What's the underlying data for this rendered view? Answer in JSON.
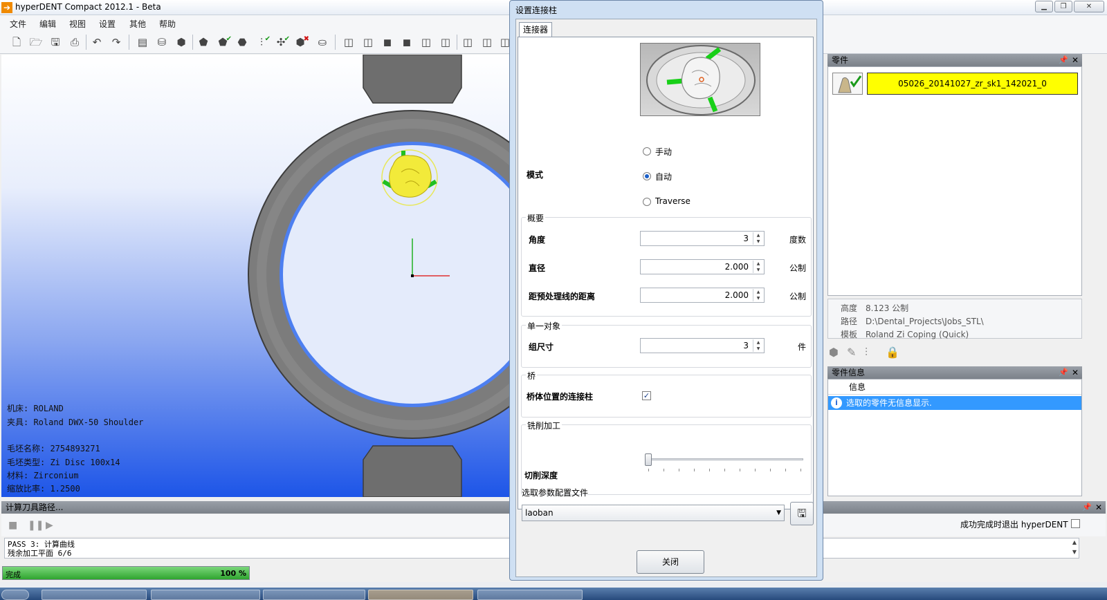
{
  "window": {
    "title": "hyperDENT Compact 2012.1 - Beta"
  },
  "menu": [
    "文件",
    "编辑",
    "视图",
    "设置",
    "其他",
    "帮助"
  ],
  "viewport_info": {
    "machine": "机床: ROLAND",
    "fixture": "夹具: Roland DWX-50 Shoulder",
    "blank_name": "毛坯名称: 2754893271",
    "blank_type": "毛坯类型: Zi Disc 100x14",
    "material": "材料: Zirconium",
    "scale": "缩放比率: 1.2500"
  },
  "toolpath": {
    "header": "计算刀具路径...",
    "log_line1": "PASS 3: 计算曲线",
    "log_line2": "残余加工平面 6/6",
    "progress_label": "完成",
    "progress_value": "100 %",
    "progress_fraction": 1.0,
    "exit_label": "成功完成时退出 hyperDENT"
  },
  "parts_panel": {
    "header": "零件",
    "part_name": "05026_20141027_zr_sk1_142021_0",
    "height_key": "高度",
    "height_val": "8.123 公制",
    "path_key": "路径",
    "path_val": "D:\\Dental_Projects\\Jobs_STL\\",
    "template_key": "模板",
    "template_val": "Roland Zi Coping (Quick)"
  },
  "info_panel": {
    "header": "零件信息",
    "column": "信息",
    "message": "选取的零件无信息显示."
  },
  "dialog": {
    "title": "设置连接柱",
    "tab": "连接器",
    "mode_label": "模式",
    "mode_options": [
      "手动",
      "自动",
      "Traverse"
    ],
    "summary_title": "概要",
    "angle_label": "角度",
    "angle_value": "3",
    "angle_unit": "度数",
    "diameter_label": "直径",
    "diameter_value": "2.000",
    "diameter_unit": "公制",
    "distance_label": "距预处理线的距离",
    "distance_value": "2.000",
    "distance_unit": "公制",
    "single_title": "单一对象",
    "group_size_label": "组尺寸",
    "group_size_value": "3",
    "group_size_unit": "件",
    "bridge_title": "桥",
    "bridge_label": "桥体位置的连接柱",
    "milling_title": "铣削加工",
    "cut_depth_label": "切削深度",
    "profile_title": "选取参数配置文件",
    "profile_value": "laoban",
    "close_label": "关闭"
  },
  "colors": {
    "selected_part": "#ffff00",
    "progress": "#2fa52f",
    "selection": "#3399ff"
  }
}
